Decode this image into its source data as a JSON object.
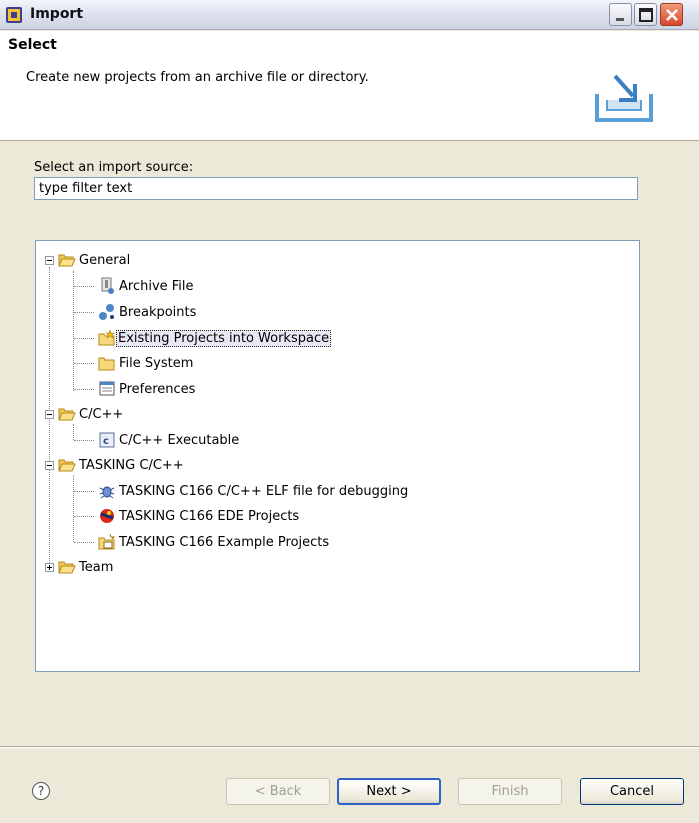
{
  "window": {
    "title": "Import"
  },
  "header": {
    "title": "Select",
    "description": "Create new projects from an archive file or directory."
  },
  "filter": {
    "label": "Select an import source:",
    "value": "type filter text"
  },
  "tree": {
    "general": "General",
    "archive_file": "Archive File",
    "breakpoints": "Breakpoints",
    "existing_projects": "Existing Projects into Workspace",
    "file_system": "File System",
    "preferences": "Preferences",
    "cpp": "C/C++",
    "cpp_executable": "C/C++ Executable",
    "tasking_cpp": "TASKING C/C++",
    "tasking_elf": "TASKING C166 C/C++ ELF file for debugging",
    "tasking_ede": "TASKING C166 EDE Projects",
    "tasking_example": "TASKING C166 Example Projects",
    "team": "Team"
  },
  "buttons": {
    "back": "< Back",
    "next": "Next >",
    "finish": "Finish",
    "cancel": "Cancel",
    "help": "?"
  }
}
